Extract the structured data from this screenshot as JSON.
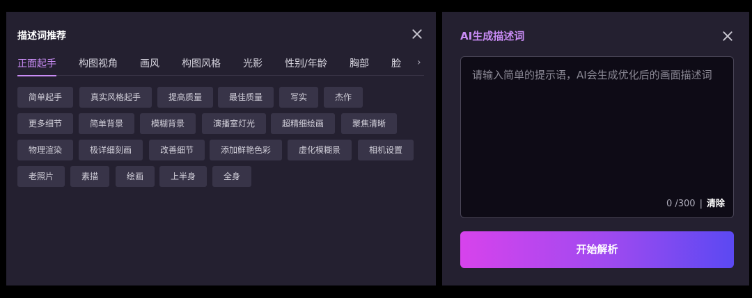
{
  "left_panel": {
    "title": "描述词推荐",
    "tabs": [
      "正面起手",
      "构图视角",
      "画风",
      "构图风格",
      "光影",
      "性别/年龄",
      "胸部",
      "脸"
    ],
    "more_icon": "chevron-right-icon",
    "chip_rows": [
      [
        "简单起手",
        "真实风格起手",
        "提高质量",
        "最佳质量",
        "写实",
        "杰作"
      ],
      [
        "更多细节",
        "简单背景",
        "模糊背景",
        "演播室灯光",
        "超精细绘画",
        "聚焦清晰"
      ],
      [
        "物理渲染",
        "极详细刻画",
        "改善细节",
        "添加鲜艳色彩",
        "虚化模糊景",
        "相机设置"
      ],
      [
        "老照片",
        "素描",
        "绘画",
        "上半身",
        "全身"
      ]
    ]
  },
  "right_panel": {
    "title": "AI生成描述词",
    "placeholder": "请输入简单的提示语，AI会生成优化后的画面描述词",
    "counter": "0 /300",
    "separator": "|",
    "clear_label": "清除",
    "start_label": "开始解析"
  },
  "colors": {
    "accent": "#c98cf5",
    "panel_bg": "#242030",
    "chip_bg": "#383448",
    "button_gradient_start": "#d743ec",
    "button_gradient_end": "#5b49f2"
  }
}
